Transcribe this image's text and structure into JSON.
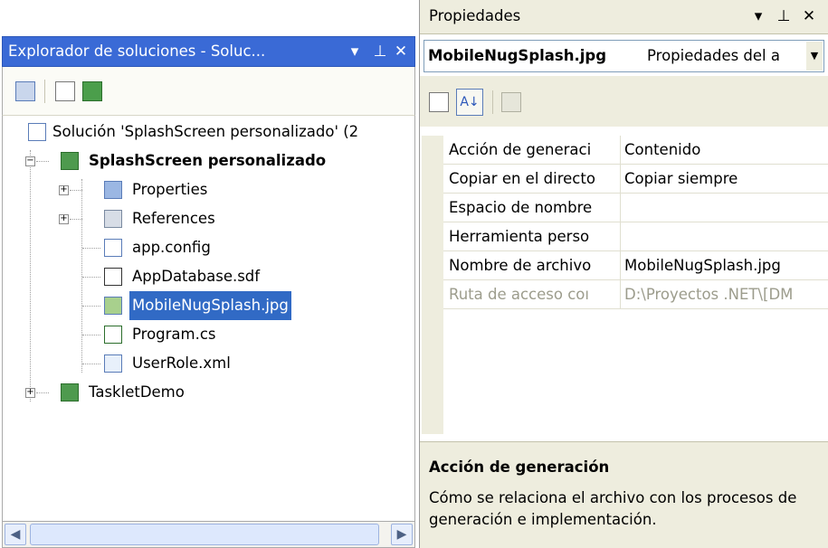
{
  "solution_explorer": {
    "title": "Explorador de soluciones - Soluc...",
    "tree": {
      "solution": "Solución 'SplashScreen personalizado' (2",
      "project": "SplashScreen personalizado",
      "items": [
        {
          "label": "Properties",
          "icon": "properties-folder-icon"
        },
        {
          "label": "References",
          "icon": "references-folder-icon"
        },
        {
          "label": "app.config",
          "icon": "config-file-icon"
        },
        {
          "label": "AppDatabase.sdf",
          "icon": "database-file-icon"
        },
        {
          "label": "MobileNugSplash.jpg",
          "icon": "image-file-icon",
          "selected": true
        },
        {
          "label": "Program.cs",
          "icon": "csharp-file-icon"
        },
        {
          "label": "UserRole.xml",
          "icon": "xml-file-icon"
        }
      ],
      "other_project": "TaskletDemo"
    }
  },
  "properties": {
    "title": "Propiedades",
    "object_name": "MobileNugSplash.jpg",
    "object_type": "Propiedades del a",
    "rows": [
      {
        "name": "Acción de generaci",
        "value": "Contenido"
      },
      {
        "name": "Copiar en el directo",
        "value": "Copiar siempre"
      },
      {
        "name": "Espacio de nombre",
        "value": ""
      },
      {
        "name": "Herramienta perso",
        "value": ""
      },
      {
        "name": "Nombre de archivo",
        "value": "MobileNugSplash.jpg"
      },
      {
        "name": "Ruta de acceso coı",
        "value": "D:\\Proyectos .NET\\[DM",
        "disabled": true
      }
    ],
    "description_title": "Acción de generación",
    "description_text": "Cómo se relaciona el archivo con los procesos de generación e implementación."
  },
  "colors": {
    "title_active": "#3a6ad6",
    "selection": "#316ac5",
    "panel_bg": "#eeedde"
  }
}
